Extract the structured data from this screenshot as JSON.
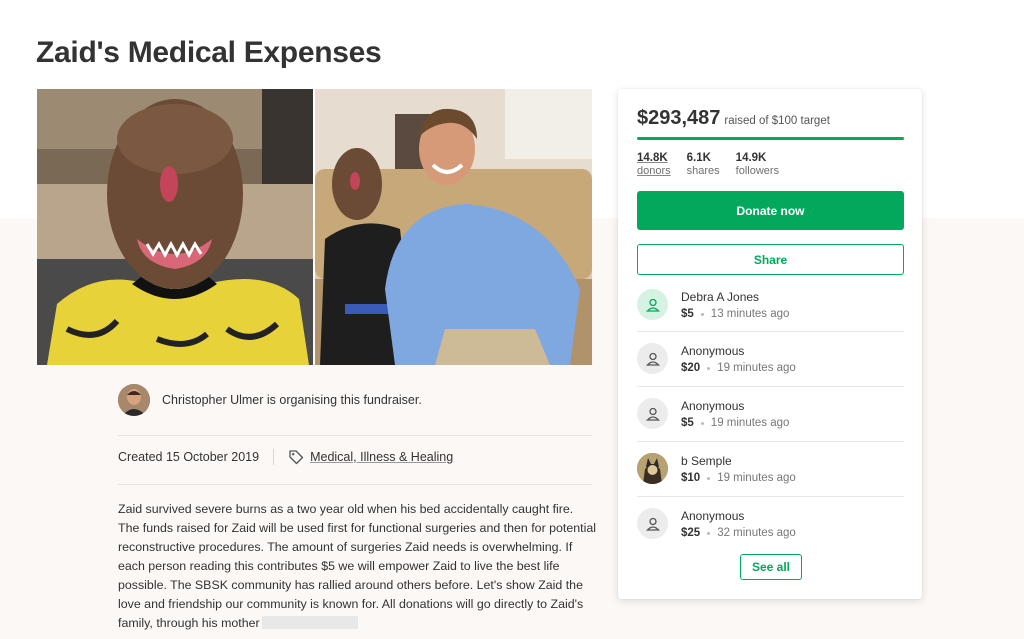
{
  "campaign": {
    "title": "Zaid's Medical Expenses"
  },
  "organiser": {
    "text": "Christopher Ulmer is organising this fundraiser."
  },
  "meta": {
    "created": "Created 15 October 2019",
    "category": "Medical, Illness & Healing"
  },
  "story": {
    "text": "Zaid survived severe burns as a two year old when his bed accidentally caught fire. The funds raised for Zaid will be used first for functional surgeries and then for potential reconstructive procedures. The amount of surgeries Zaid needs is overwhelming. If each person reading this contributes $5 we will empower Zaid to live the best life possible. The SBSK community has rallied around others before. Let's show Zaid the love and friendship our community is known for. All donations will go directly to Zaid's family, through his mother"
  },
  "donate_card": {
    "raised_amount": "$293,487",
    "raised_of": "raised of $100 target",
    "progress": 1.0,
    "stats": [
      {
        "value": "14.8K",
        "label": "donors"
      },
      {
        "value": "6.1K",
        "label": "shares"
      },
      {
        "value": "14.9K",
        "label": "followers"
      }
    ],
    "donate_label": "Donate now",
    "share_label": "Share",
    "see_all_label": "See all",
    "accent_color": "#02a95c"
  },
  "donations": [
    {
      "name": "Debra A Jones",
      "amount": "$5",
      "time": "13 minutes ago",
      "avatar": "user-icon"
    },
    {
      "name": "Anonymous",
      "amount": "$20",
      "time": "19 minutes ago",
      "avatar": "user-icon"
    },
    {
      "name": "Anonymous",
      "amount": "$5",
      "time": "19 minutes ago",
      "avatar": "user-icon"
    },
    {
      "name": "b Semple",
      "amount": "$10",
      "time": "19 minutes ago",
      "avatar": "photo"
    },
    {
      "name": "Anonymous",
      "amount": "$25",
      "time": "32 minutes ago",
      "avatar": "user-icon"
    }
  ]
}
